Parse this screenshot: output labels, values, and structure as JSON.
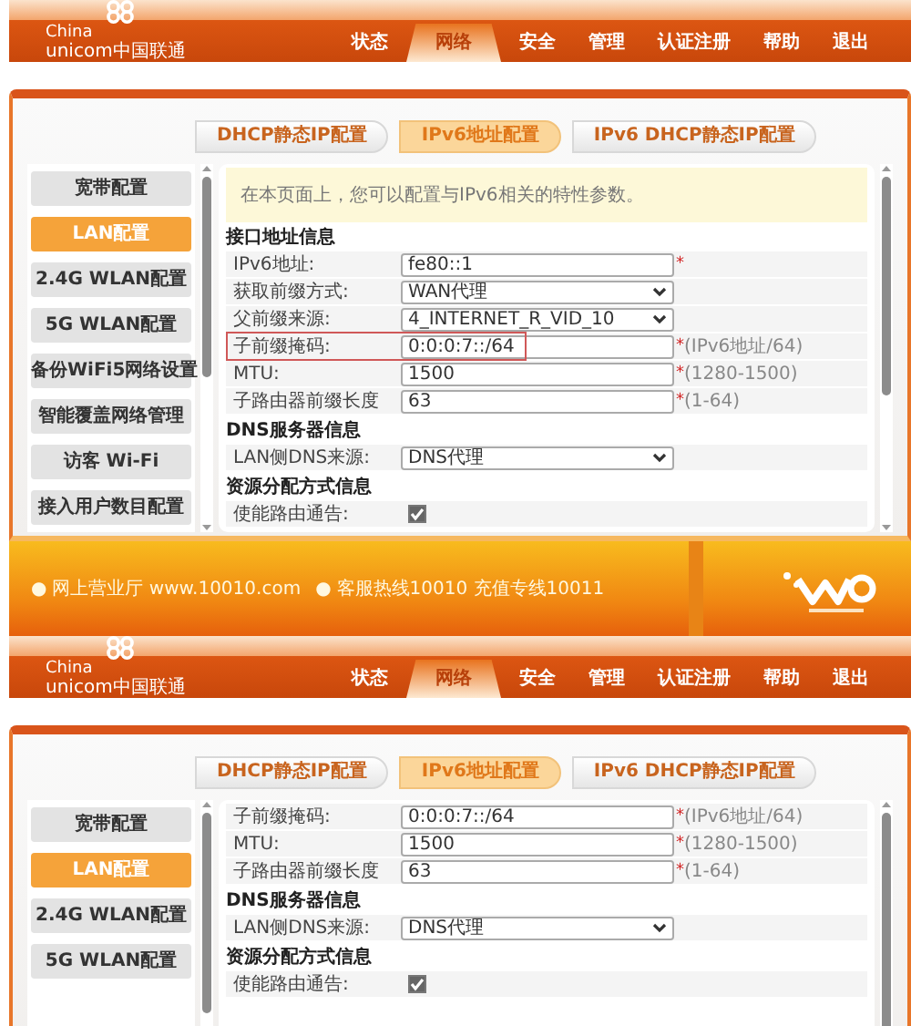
{
  "screens": [
    {
      "header": {
        "logo": {
          "line1": "China",
          "line2": "unicom中国联通"
        },
        "nav": [
          {
            "label": "状态",
            "selected": false
          },
          {
            "label": "网络",
            "selected": true
          },
          {
            "label": "安全",
            "selected": false
          },
          {
            "label": "管理",
            "selected": false
          },
          {
            "label": "认证注册",
            "selected": false
          },
          {
            "label": "帮助",
            "selected": false
          },
          {
            "label": "退出",
            "selected": false
          }
        ]
      },
      "tabs": [
        {
          "label": "DHCP静态IP配置",
          "selected": false
        },
        {
          "label": "IPv6地址配置",
          "selected": true
        },
        {
          "label": "IPv6 DHCP静态IP配置",
          "selected": false
        }
      ],
      "sidebar": [
        {
          "label": "宽带配置",
          "selected": false
        },
        {
          "label": "LAN配置",
          "selected": true
        },
        {
          "label": "2.4G WLAN配置",
          "selected": false
        },
        {
          "label": "5G WLAN配置",
          "selected": false
        },
        {
          "label": "备份WiFi5网络设置",
          "selected": false
        },
        {
          "label": "智能覆盖网络管理",
          "selected": false
        },
        {
          "label": "访客 Wi-Fi",
          "selected": false
        },
        {
          "label": "接入用户数目配置",
          "selected": false
        }
      ],
      "notice": "在本页面上，您可以配置与IPv6相关的特性参数。",
      "form": [
        {
          "kind": "section",
          "label": "接口地址信息"
        },
        {
          "kind": "text",
          "label": "IPv6地址:",
          "value": "fe80::1",
          "mark": "*",
          "highlighted": false
        },
        {
          "kind": "select",
          "label": "获取前缀方式:",
          "value": "WAN代理",
          "highlighted": false
        },
        {
          "kind": "select",
          "label": "父前缀来源:",
          "value": "4_INTERNET_R_VID_10",
          "highlighted": false
        },
        {
          "kind": "text",
          "label": "子前缀掩码:",
          "value": "0:0:0:7::/64",
          "mark": "*",
          "hint": "(IPv6地址/64)",
          "highlighted": true
        },
        {
          "kind": "text",
          "label": "MTU:",
          "value": "1500",
          "mark": "*",
          "hint": "(1280-1500)",
          "highlighted": false
        },
        {
          "kind": "text",
          "label": "子路由器前缀长度",
          "value": "63",
          "mark": "*",
          "hint": "(1-64)",
          "highlighted": false
        },
        {
          "kind": "section",
          "label": "DNS服务器信息"
        },
        {
          "kind": "select",
          "label": "LAN侧DNS来源:",
          "value": "DNS代理",
          "highlighted": false
        },
        {
          "kind": "section",
          "label": "资源分配方式信息"
        },
        {
          "kind": "checkbox",
          "label": "使能路由通告:",
          "checked": true
        }
      ],
      "footer": {
        "items": [
          {
            "bullet": "●",
            "text": "网上营业厅 www.10010.com"
          },
          {
            "bullet": "●",
            "text": "客服热线10010 充值专线10011"
          }
        ]
      }
    },
    {
      "header": {
        "logo": {
          "line1": "China",
          "line2": "unicom中国联通"
        },
        "nav": [
          {
            "label": "状态",
            "selected": false
          },
          {
            "label": "网络",
            "selected": true
          },
          {
            "label": "安全",
            "selected": false
          },
          {
            "label": "管理",
            "selected": false
          },
          {
            "label": "认证注册",
            "selected": false
          },
          {
            "label": "帮助",
            "selected": false
          },
          {
            "label": "退出",
            "selected": false
          }
        ]
      },
      "tabs": [
        {
          "label": "DHCP静态IP配置",
          "selected": false
        },
        {
          "label": "IPv6地址配置",
          "selected": true
        },
        {
          "label": "IPv6 DHCP静态IP配置",
          "selected": false
        }
      ],
      "sidebar": [
        {
          "label": "宽带配置",
          "selected": false
        },
        {
          "label": "LAN配置",
          "selected": true
        },
        {
          "label": "2.4G WLAN配置",
          "selected": false
        },
        {
          "label": "5G WLAN配置",
          "selected": false
        }
      ],
      "form": [
        {
          "kind": "text",
          "label": "子前缀掩码:",
          "value": "0:0:0:7::/64",
          "mark": "*",
          "hint": "(IPv6地址/64)",
          "highlighted": false
        },
        {
          "kind": "text",
          "label": "MTU:",
          "value": "1500",
          "mark": "*",
          "hint": "(1280-1500)",
          "highlighted": false
        },
        {
          "kind": "text",
          "label": "子路由器前缀长度",
          "value": "63",
          "mark": "*",
          "hint": "(1-64)",
          "highlighted": false
        },
        {
          "kind": "section",
          "label": "DNS服务器信息"
        },
        {
          "kind": "select",
          "label": "LAN侧DNS来源:",
          "value": "DNS代理",
          "highlighted": false
        },
        {
          "kind": "section",
          "label": "资源分配方式信息"
        },
        {
          "kind": "checkbox",
          "label": "使能路由通告:",
          "checked": true
        }
      ]
    }
  ]
}
